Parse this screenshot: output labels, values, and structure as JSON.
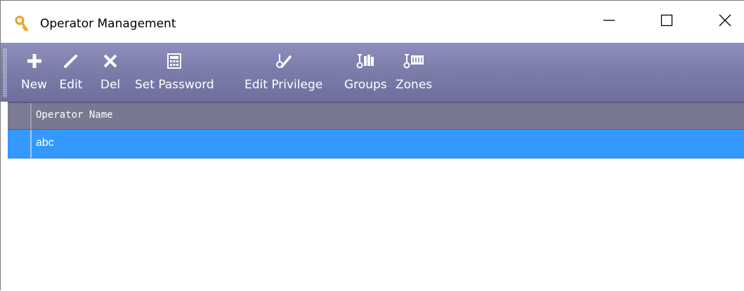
{
  "window": {
    "title": "Operator Management",
    "icon": "key-icon"
  },
  "window_controls": {
    "minimize": "minimize-icon",
    "maximize": "maximize-icon",
    "close": "close-icon"
  },
  "toolbar": {
    "items": [
      {
        "label": "New",
        "icon": "plus-icon"
      },
      {
        "label": "Edit",
        "icon": "pencil-icon"
      },
      {
        "label": "Del",
        "icon": "x-icon"
      },
      {
        "label": "Set Password",
        "icon": "calculator-icon"
      },
      {
        "label": "Edit Privilege",
        "icon": "key-pen-icon"
      },
      {
        "label": "Groups",
        "icon": "groups-icon"
      },
      {
        "label": "Zones",
        "icon": "zones-icon"
      }
    ]
  },
  "grid": {
    "columns": [
      "Operator Name"
    ],
    "rows": [
      {
        "operator_name": "abc",
        "selected": true
      }
    ]
  },
  "colors": {
    "toolbar": "#7d7dab",
    "header": "#787891",
    "selection": "#3399ff"
  }
}
